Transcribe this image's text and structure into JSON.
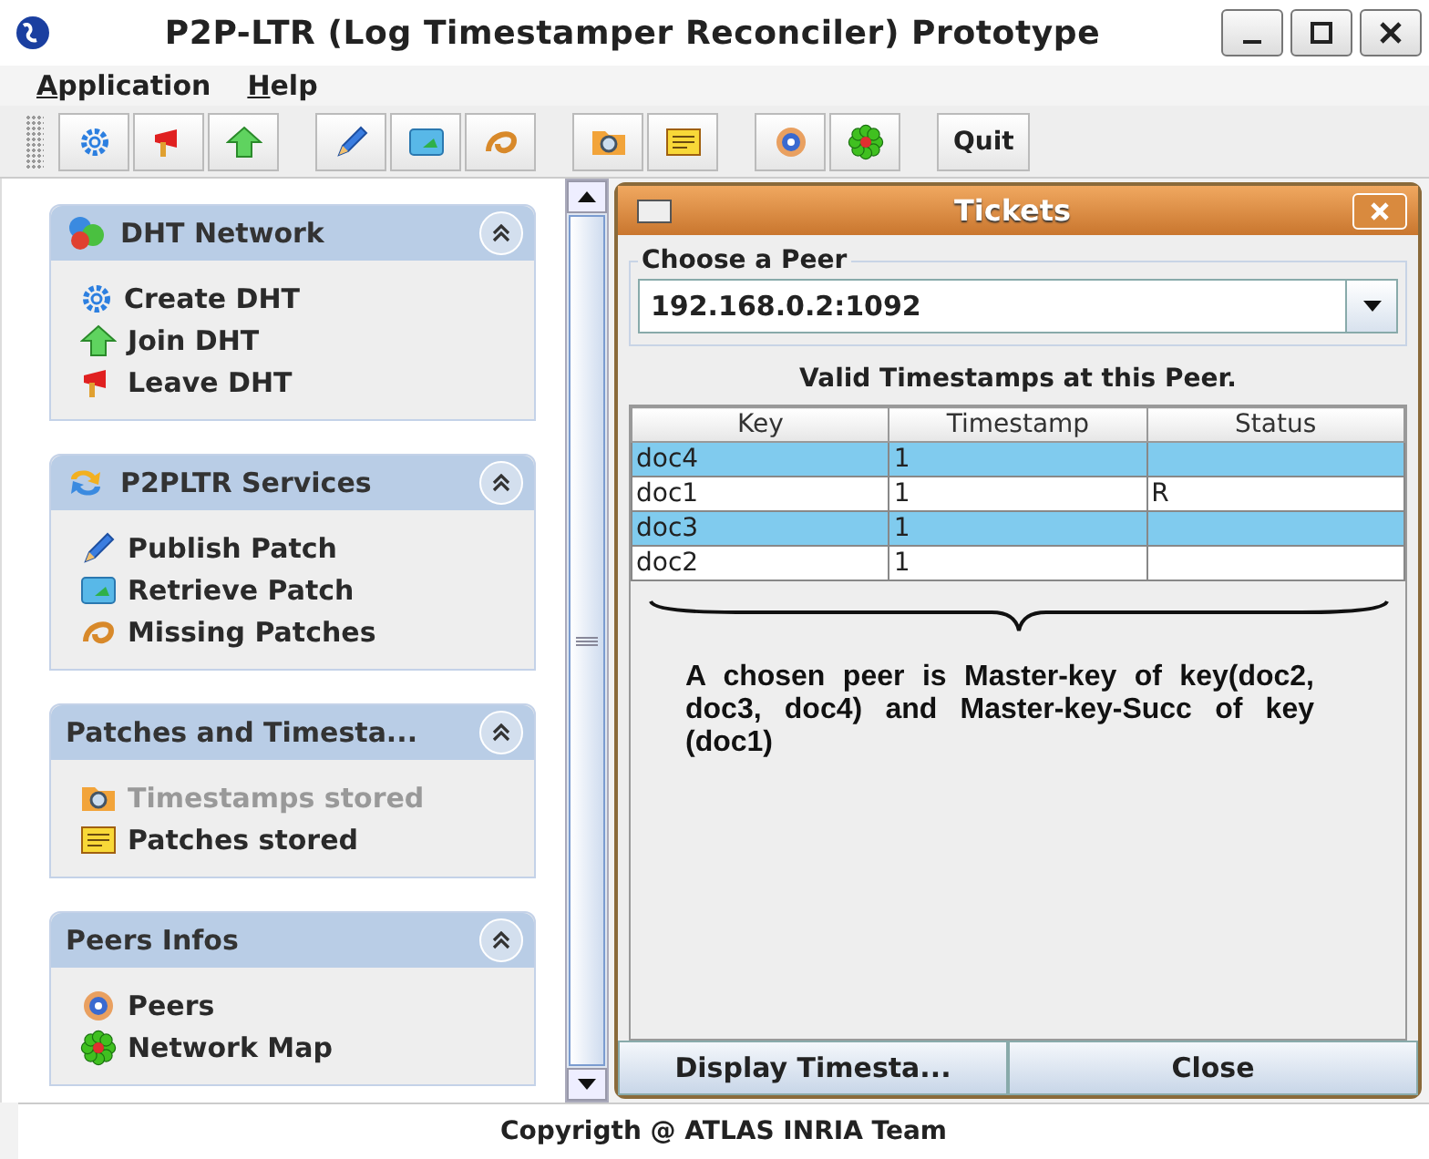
{
  "window": {
    "title": "P2P-LTR (Log Timestamper Reconciler) Prototype"
  },
  "menu": [
    {
      "label": "Application"
    },
    {
      "label": "Help"
    }
  ],
  "toolbar": {
    "quit": "Quit"
  },
  "sidebar": {
    "sections": [
      {
        "title": "DHT Network",
        "items": [
          {
            "label": "Create DHT",
            "disabled": false
          },
          {
            "label": "Join DHT",
            "disabled": false
          },
          {
            "label": "Leave DHT",
            "disabled": false
          }
        ]
      },
      {
        "title": "P2PLTR Services",
        "items": [
          {
            "label": "Publish Patch",
            "disabled": false
          },
          {
            "label": "Retrieve Patch",
            "disabled": false
          },
          {
            "label": "Missing Patches",
            "disabled": false
          }
        ]
      },
      {
        "title": "Patches and Timesta...",
        "items": [
          {
            "label": "Timestamps stored",
            "disabled": true
          },
          {
            "label": "Patches stored",
            "disabled": false
          }
        ]
      },
      {
        "title": "Peers Infos",
        "items": [
          {
            "label": "Peers",
            "disabled": false
          },
          {
            "label": "Network Map",
            "disabled": false
          }
        ]
      }
    ]
  },
  "dialog": {
    "title": "Tickets",
    "peer_group": "Choose a Peer",
    "peer": "192.168.0.2:1092",
    "table_title": "Valid Timestamps at this Peer.",
    "columns": [
      "Key",
      "Timestamp",
      "Status"
    ],
    "rows": [
      {
        "cells": [
          "doc4",
          "1",
          ""
        ],
        "selected": true
      },
      {
        "cells": [
          "doc1",
          "1",
          "R"
        ],
        "selected": false
      },
      {
        "cells": [
          "doc3",
          "1",
          ""
        ],
        "selected": true
      },
      {
        "cells": [
          "doc2",
          "1",
          ""
        ],
        "selected": false
      }
    ],
    "note": "A chosen peer is Master-key of key(doc2, doc3, doc4) and Master-key-Succ of key (doc1)",
    "buttons": [
      "Display Timesta...",
      "Close"
    ]
  },
  "footer": "Copyrigth @ ATLAS INRIA Team"
}
